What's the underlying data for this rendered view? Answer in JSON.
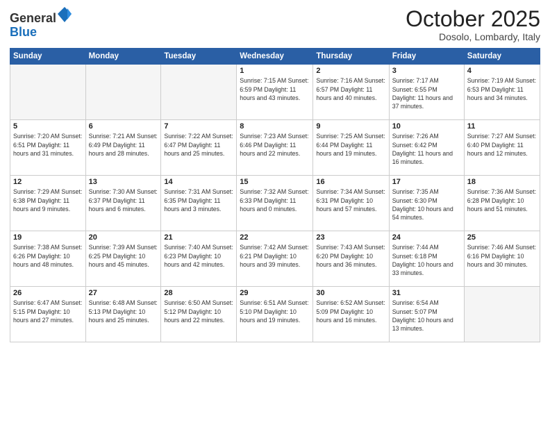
{
  "header": {
    "logo_general": "General",
    "logo_blue": "Blue",
    "month_title": "October 2025",
    "location": "Dosolo, Lombardy, Italy"
  },
  "days_of_week": [
    "Sunday",
    "Monday",
    "Tuesday",
    "Wednesday",
    "Thursday",
    "Friday",
    "Saturday"
  ],
  "weeks": [
    [
      {
        "day": "",
        "info": ""
      },
      {
        "day": "",
        "info": ""
      },
      {
        "day": "",
        "info": ""
      },
      {
        "day": "1",
        "info": "Sunrise: 7:15 AM\nSunset: 6:59 PM\nDaylight: 11 hours and 43 minutes."
      },
      {
        "day": "2",
        "info": "Sunrise: 7:16 AM\nSunset: 6:57 PM\nDaylight: 11 hours and 40 minutes."
      },
      {
        "day": "3",
        "info": "Sunrise: 7:17 AM\nSunset: 6:55 PM\nDaylight: 11 hours and 37 minutes."
      },
      {
        "day": "4",
        "info": "Sunrise: 7:19 AM\nSunset: 6:53 PM\nDaylight: 11 hours and 34 minutes."
      }
    ],
    [
      {
        "day": "5",
        "info": "Sunrise: 7:20 AM\nSunset: 6:51 PM\nDaylight: 11 hours and 31 minutes."
      },
      {
        "day": "6",
        "info": "Sunrise: 7:21 AM\nSunset: 6:49 PM\nDaylight: 11 hours and 28 minutes."
      },
      {
        "day": "7",
        "info": "Sunrise: 7:22 AM\nSunset: 6:47 PM\nDaylight: 11 hours and 25 minutes."
      },
      {
        "day": "8",
        "info": "Sunrise: 7:23 AM\nSunset: 6:46 PM\nDaylight: 11 hours and 22 minutes."
      },
      {
        "day": "9",
        "info": "Sunrise: 7:25 AM\nSunset: 6:44 PM\nDaylight: 11 hours and 19 minutes."
      },
      {
        "day": "10",
        "info": "Sunrise: 7:26 AM\nSunset: 6:42 PM\nDaylight: 11 hours and 16 minutes."
      },
      {
        "day": "11",
        "info": "Sunrise: 7:27 AM\nSunset: 6:40 PM\nDaylight: 11 hours and 12 minutes."
      }
    ],
    [
      {
        "day": "12",
        "info": "Sunrise: 7:29 AM\nSunset: 6:38 PM\nDaylight: 11 hours and 9 minutes."
      },
      {
        "day": "13",
        "info": "Sunrise: 7:30 AM\nSunset: 6:37 PM\nDaylight: 11 hours and 6 minutes."
      },
      {
        "day": "14",
        "info": "Sunrise: 7:31 AM\nSunset: 6:35 PM\nDaylight: 11 hours and 3 minutes."
      },
      {
        "day": "15",
        "info": "Sunrise: 7:32 AM\nSunset: 6:33 PM\nDaylight: 11 hours and 0 minutes."
      },
      {
        "day": "16",
        "info": "Sunrise: 7:34 AM\nSunset: 6:31 PM\nDaylight: 10 hours and 57 minutes."
      },
      {
        "day": "17",
        "info": "Sunrise: 7:35 AM\nSunset: 6:30 PM\nDaylight: 10 hours and 54 minutes."
      },
      {
        "day": "18",
        "info": "Sunrise: 7:36 AM\nSunset: 6:28 PM\nDaylight: 10 hours and 51 minutes."
      }
    ],
    [
      {
        "day": "19",
        "info": "Sunrise: 7:38 AM\nSunset: 6:26 PM\nDaylight: 10 hours and 48 minutes."
      },
      {
        "day": "20",
        "info": "Sunrise: 7:39 AM\nSunset: 6:25 PM\nDaylight: 10 hours and 45 minutes."
      },
      {
        "day": "21",
        "info": "Sunrise: 7:40 AM\nSunset: 6:23 PM\nDaylight: 10 hours and 42 minutes."
      },
      {
        "day": "22",
        "info": "Sunrise: 7:42 AM\nSunset: 6:21 PM\nDaylight: 10 hours and 39 minutes."
      },
      {
        "day": "23",
        "info": "Sunrise: 7:43 AM\nSunset: 6:20 PM\nDaylight: 10 hours and 36 minutes."
      },
      {
        "day": "24",
        "info": "Sunrise: 7:44 AM\nSunset: 6:18 PM\nDaylight: 10 hours and 33 minutes."
      },
      {
        "day": "25",
        "info": "Sunrise: 7:46 AM\nSunset: 6:16 PM\nDaylight: 10 hours and 30 minutes."
      }
    ],
    [
      {
        "day": "26",
        "info": "Sunrise: 6:47 AM\nSunset: 5:15 PM\nDaylight: 10 hours and 27 minutes."
      },
      {
        "day": "27",
        "info": "Sunrise: 6:48 AM\nSunset: 5:13 PM\nDaylight: 10 hours and 25 minutes."
      },
      {
        "day": "28",
        "info": "Sunrise: 6:50 AM\nSunset: 5:12 PM\nDaylight: 10 hours and 22 minutes."
      },
      {
        "day": "29",
        "info": "Sunrise: 6:51 AM\nSunset: 5:10 PM\nDaylight: 10 hours and 19 minutes."
      },
      {
        "day": "30",
        "info": "Sunrise: 6:52 AM\nSunset: 5:09 PM\nDaylight: 10 hours and 16 minutes."
      },
      {
        "day": "31",
        "info": "Sunrise: 6:54 AM\nSunset: 5:07 PM\nDaylight: 10 hours and 13 minutes."
      },
      {
        "day": "",
        "info": ""
      }
    ]
  ]
}
